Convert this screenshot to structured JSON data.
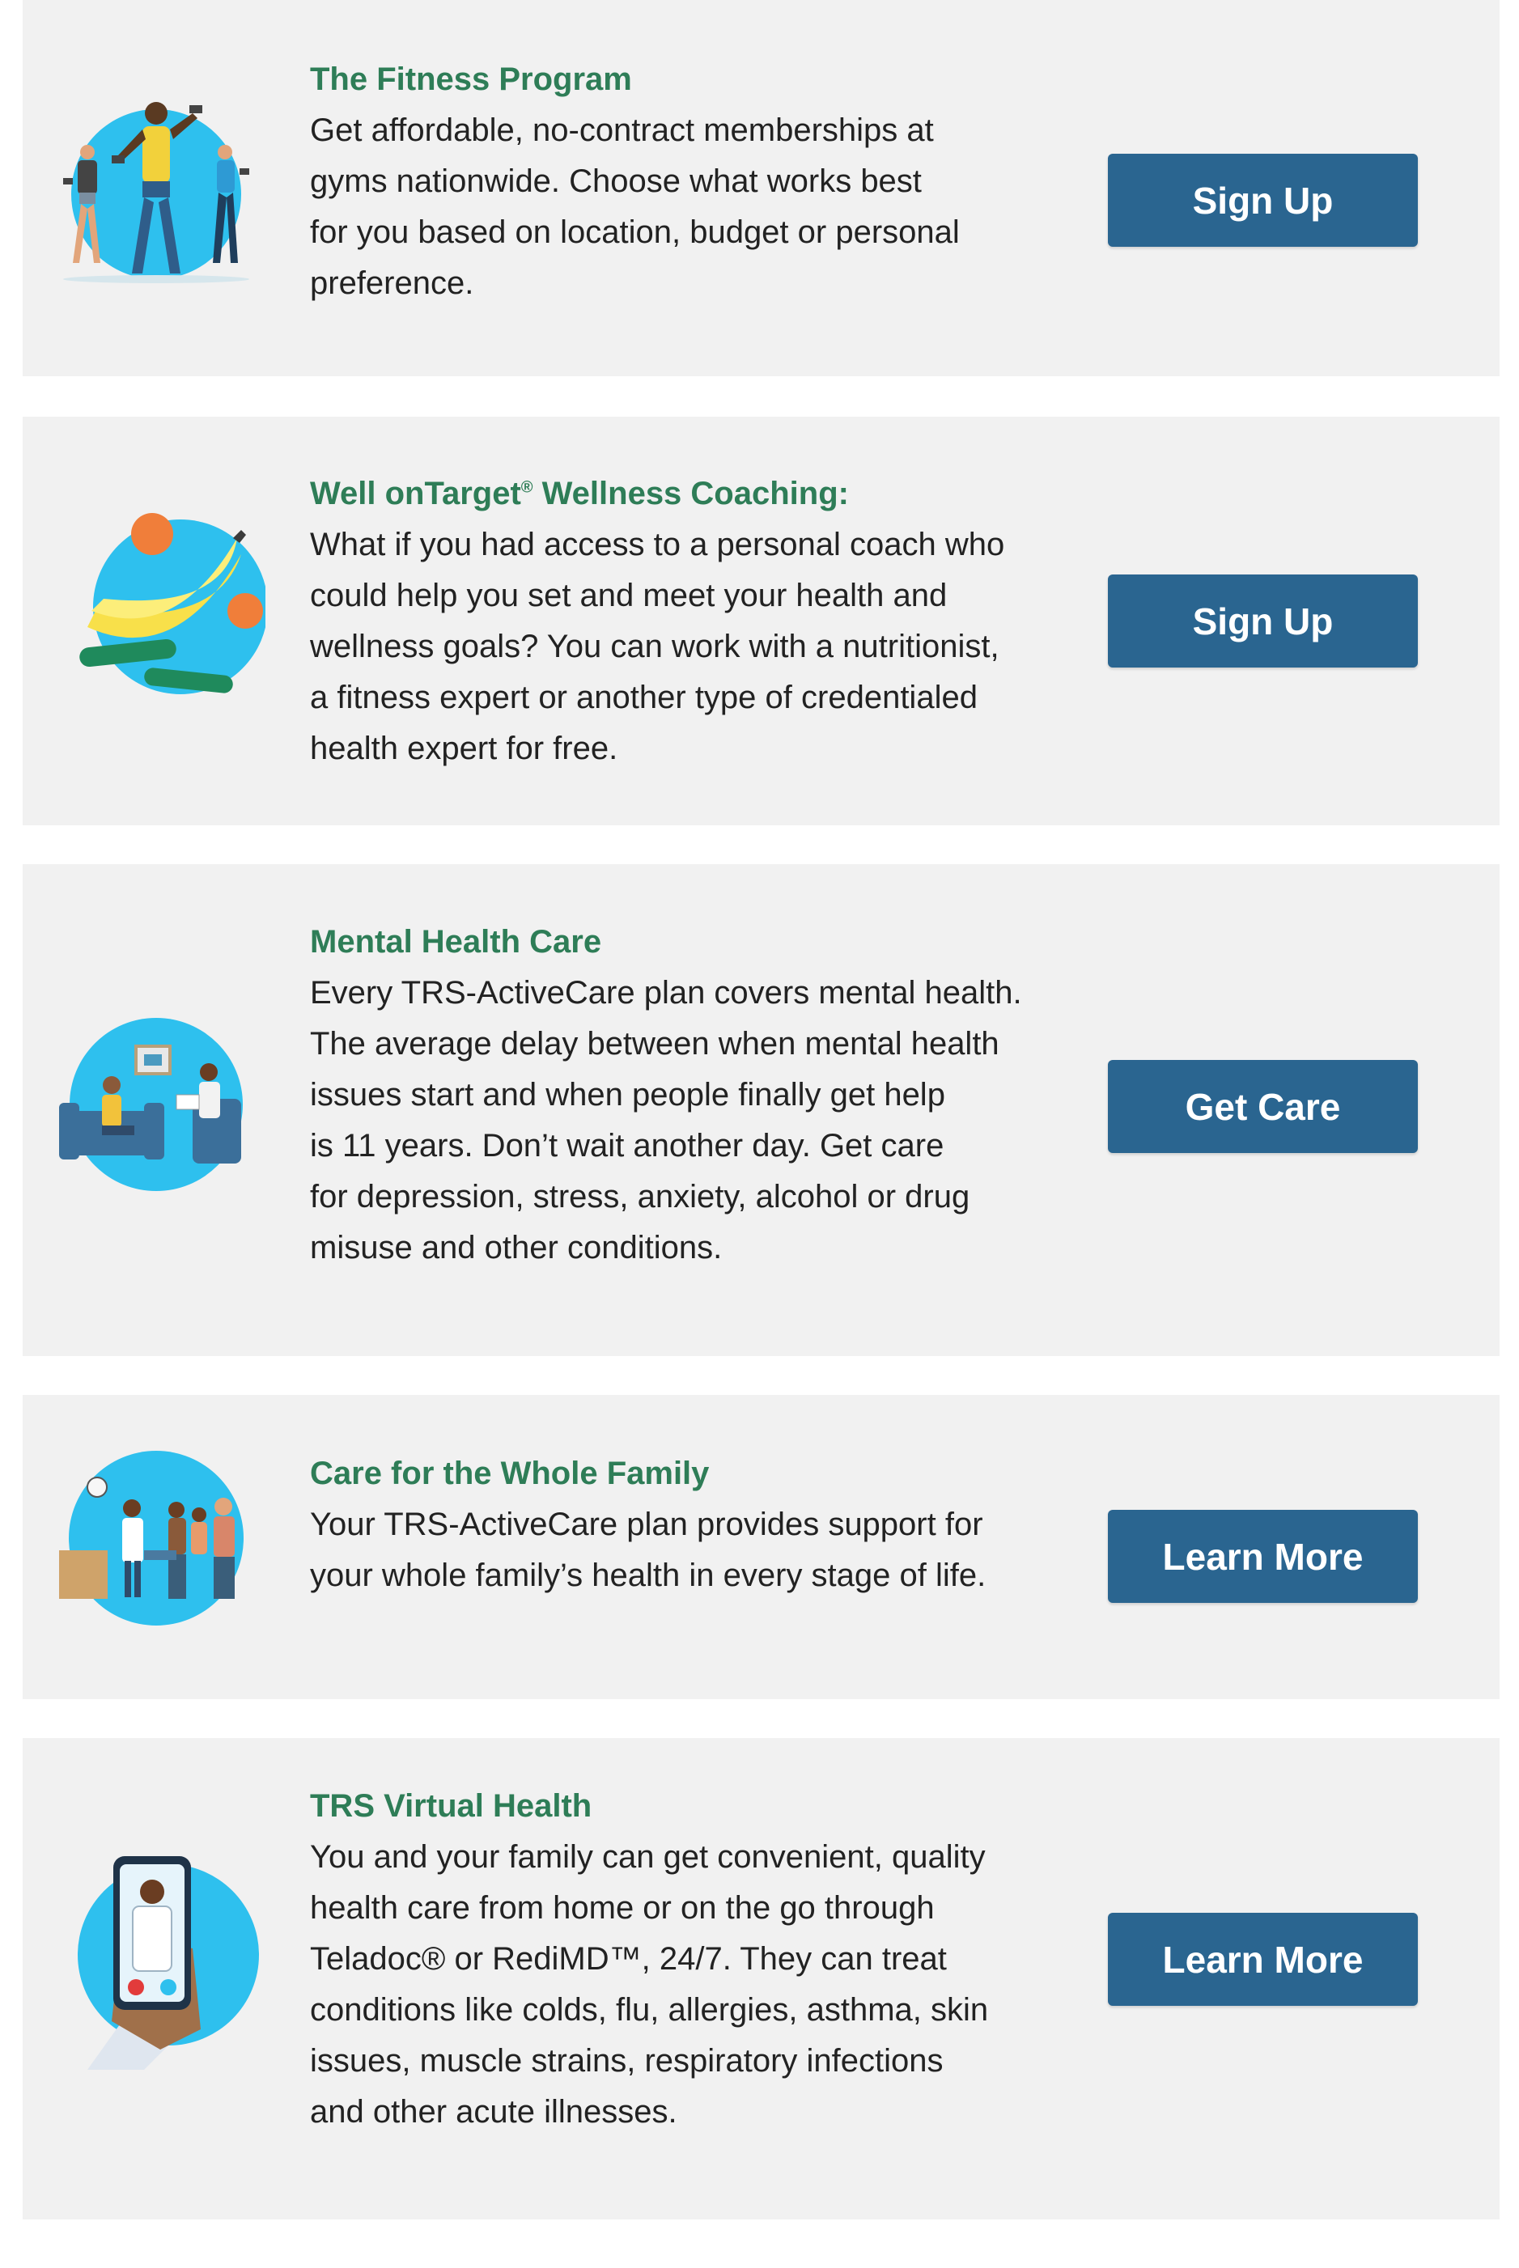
{
  "colors": {
    "card_bg": "#f1f1f1",
    "title_green": "#2e7d57",
    "button_blue": "#2a6590",
    "circle_blue": "#2ec0ee"
  },
  "cards": [
    {
      "title": "The Fitness Program",
      "body": "Get affordable, no-contract memberships at\ngyms nationwide. Choose what works best\nfor you based on location, budget or personal\npreference.",
      "button": "Sign Up",
      "icon": "fitness-people-icon"
    },
    {
      "title_prefix": "Well onTarget",
      "title_mark": "®",
      "title_suffix": " Wellness Coaching:",
      "body": "What if you had access to a personal coach who\ncould help you set and meet your health and\nwellness goals? You can work with a nutritionist,\na fitness expert or another type of credentialed\nhealth expert for free.",
      "button": "Sign Up",
      "icon": "fruit-vegetables-icon"
    },
    {
      "title": "Mental Health Care",
      "body": "Every TRS-ActiveCare plan covers mental health.\nThe average delay between when mental health\nissues start and when people finally get help\nis 11 years. Don’t wait another day. Get care\nfor depression, stress, anxiety, alcohol or drug\nmisuse and other conditions.",
      "button": "Get Care",
      "icon": "therapy-session-icon"
    },
    {
      "title": "Care for the Whole Family",
      "body": "Your TRS-ActiveCare plan provides support for\nyour whole family’s health in every stage of life.",
      "button": "Learn More",
      "icon": "family-doctor-icon"
    },
    {
      "title": "TRS Virtual Health",
      "body": "You and your family can get convenient, quality\nhealth care from home or on the go through\nTeladoc® or RediMD™, 24/7. They can treat\nconditions like colds, flu, allergies, asthma, skin\nissues, muscle strains, respiratory infections\nand other acute illnesses.",
      "button": "Learn More",
      "icon": "phone-video-call-icon"
    }
  ]
}
